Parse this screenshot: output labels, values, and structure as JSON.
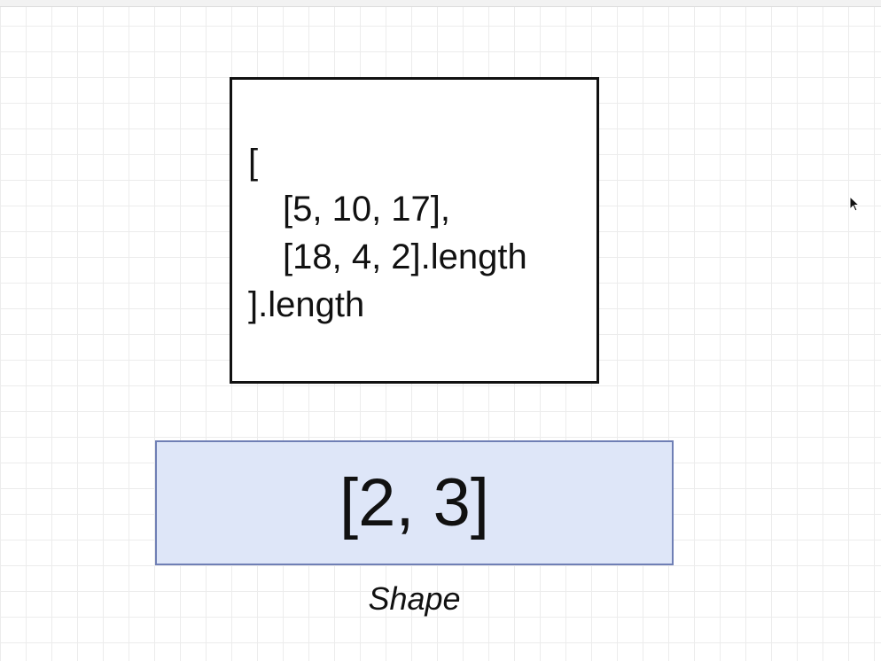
{
  "code_box": {
    "lines": [
      "[",
      "[5, 10, 17],",
      "[18, 4, 2].length",
      "].length"
    ]
  },
  "shape_box": {
    "value": "[2, 3]",
    "caption": "Shape"
  },
  "colors": {
    "shape_fill": "#dee6f8",
    "shape_border": "#6f7fb5",
    "code_border": "#111111",
    "grid": "#ececec"
  },
  "icons": {
    "cursor": "mouse-pointer-icon"
  }
}
